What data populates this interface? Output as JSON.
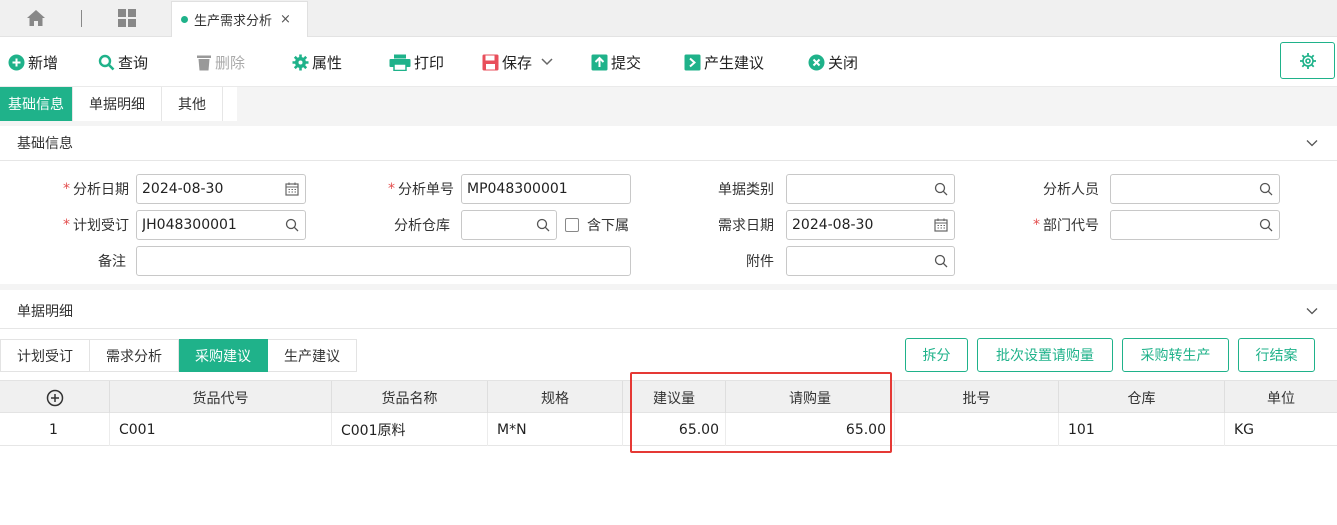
{
  "top_tabs": {
    "doc_tab_label": "生产需求分析",
    "close_glyph": "×"
  },
  "toolbar": {
    "add": "新增",
    "query": "查询",
    "delete": "删除",
    "attributes": "属性",
    "print": "打印",
    "save": "保存",
    "submit": "提交",
    "suggest": "产生建议",
    "close": "关闭"
  },
  "section_tabs": [
    "基础信息",
    "单据明细",
    "其他"
  ],
  "basic_section": {
    "title": "基础信息"
  },
  "form": {
    "analysis_date": {
      "label": "分析日期",
      "value": "2024-08-30"
    },
    "analysis_no": {
      "label": "分析单号",
      "value": "MP048300001"
    },
    "doc_type": {
      "label": "单据类别",
      "value": ""
    },
    "analyst": {
      "label": "分析人员",
      "value": ""
    },
    "plan_order": {
      "label": "计划受订",
      "value": "JH048300001"
    },
    "warehouse": {
      "label": "分析仓库",
      "value": ""
    },
    "include_sub": {
      "label": "含下属"
    },
    "demand_date": {
      "label": "需求日期",
      "value": "2024-08-30"
    },
    "dept_code": {
      "label": "部门代号",
      "value": ""
    },
    "remark": {
      "label": "备注",
      "value": ""
    },
    "attachment": {
      "label": "附件",
      "value": ""
    },
    "required_mark": "*"
  },
  "detail_section": {
    "title": "单据明细"
  },
  "sub_tabs": [
    "计划受订",
    "需求分析",
    "采购建议",
    "生产建议"
  ],
  "actions": {
    "split": "拆分",
    "batch_set": "批次设置请购量",
    "to_production": "采购转生产",
    "close_line": "行结案"
  },
  "grid": {
    "headers": [
      "货品代号",
      "货品名称",
      "规格",
      "建议量",
      "请购量",
      "批号",
      "仓库",
      "单位"
    ],
    "rows": [
      {
        "no": "1",
        "code": "C001",
        "name": "C001原料",
        "spec": "M*N",
        "suggest_qty": "65.00",
        "request_qty": "65.00",
        "batch": "",
        "warehouse": "101",
        "unit": "KG"
      }
    ]
  },
  "colors": {
    "accent": "#1fb28a",
    "highlight": "#e53935"
  }
}
